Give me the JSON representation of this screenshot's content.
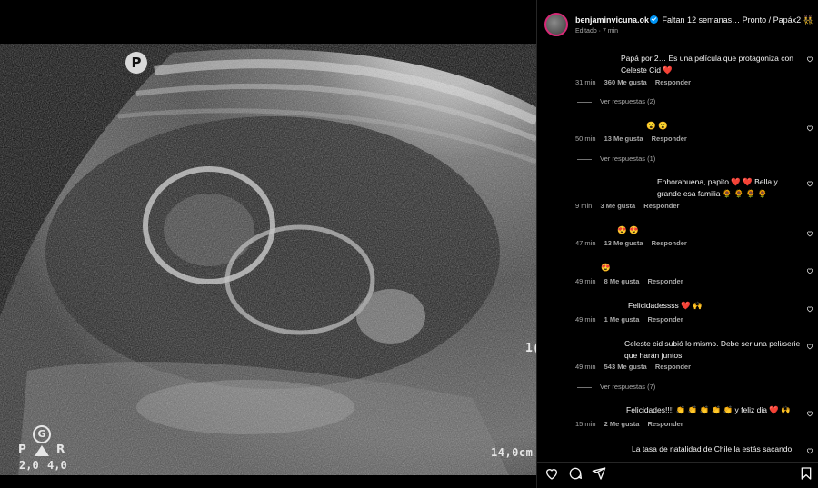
{
  "media": {
    "badge_letter": "P",
    "depth_label": "14,0cm",
    "edge_label": "1(",
    "gain": {
      "center": "G",
      "left": "P",
      "right": "R",
      "value_left": "2,0",
      "value_right": "4,0"
    }
  },
  "post": {
    "username": "benjaminvicuna.ok",
    "caption": "Faltan 12 semanas… Pronto / Papáx2 👯",
    "edited": "Editado · 7 min"
  },
  "comments": [
    {
      "text": "Papá por 2… Es una película que protagoniza con Celeste Cid ❤️",
      "time": "31 min",
      "likes": "360 Me gusta",
      "reply": "Responder",
      "view_replies": "Ver respuestas (2)"
    },
    {
      "text": "😮 😮",
      "time": "50 min",
      "likes": "13 Me gusta",
      "reply": "Responder",
      "view_replies": "Ver respuestas (1)"
    },
    {
      "text": "Enhorabuena, papito ❤️ ❤️ Bella y grande esa familia 🌻 🌻 🌻 🌻",
      "time": "9 min",
      "likes": "3 Me gusta",
      "reply": "Responder"
    },
    {
      "text": "😍 😍",
      "time": "47 min",
      "likes": "13 Me gusta",
      "reply": "Responder"
    },
    {
      "text": "😍",
      "time": "49 min",
      "likes": "8 Me gusta",
      "reply": "Responder"
    },
    {
      "text": "Felicidadessss ❤️ 🙌",
      "time": "49 min",
      "likes": "1 Me gusta",
      "reply": "Responder"
    },
    {
      "text": "Celeste cid subió lo mismo. Debe ser una peli/serie que harán juntos",
      "time": "49 min",
      "likes": "543 Me gusta",
      "reply": "Responder",
      "view_replies": "Ver respuestas (7)"
    },
    {
      "text": "Felicidades!!!! 👏 👏 👏 👏 👏 y feliz dia ❤️ 🙌",
      "time": "15 min",
      "likes": "2 Me gusta",
      "reply": "Responder"
    },
    {
      "text": "La tasa de natalidad de Chile la estás sacando",
      "time": "",
      "likes": "",
      "reply": ""
    }
  ],
  "icons": {
    "like": "heart-outline-icon",
    "comment": "comment-bubble-icon",
    "share": "paper-plane-icon",
    "save": "bookmark-icon"
  },
  "colors": {
    "verified": "#0095f6",
    "heart": "#ff3040",
    "meta": "#a8a8a8"
  }
}
